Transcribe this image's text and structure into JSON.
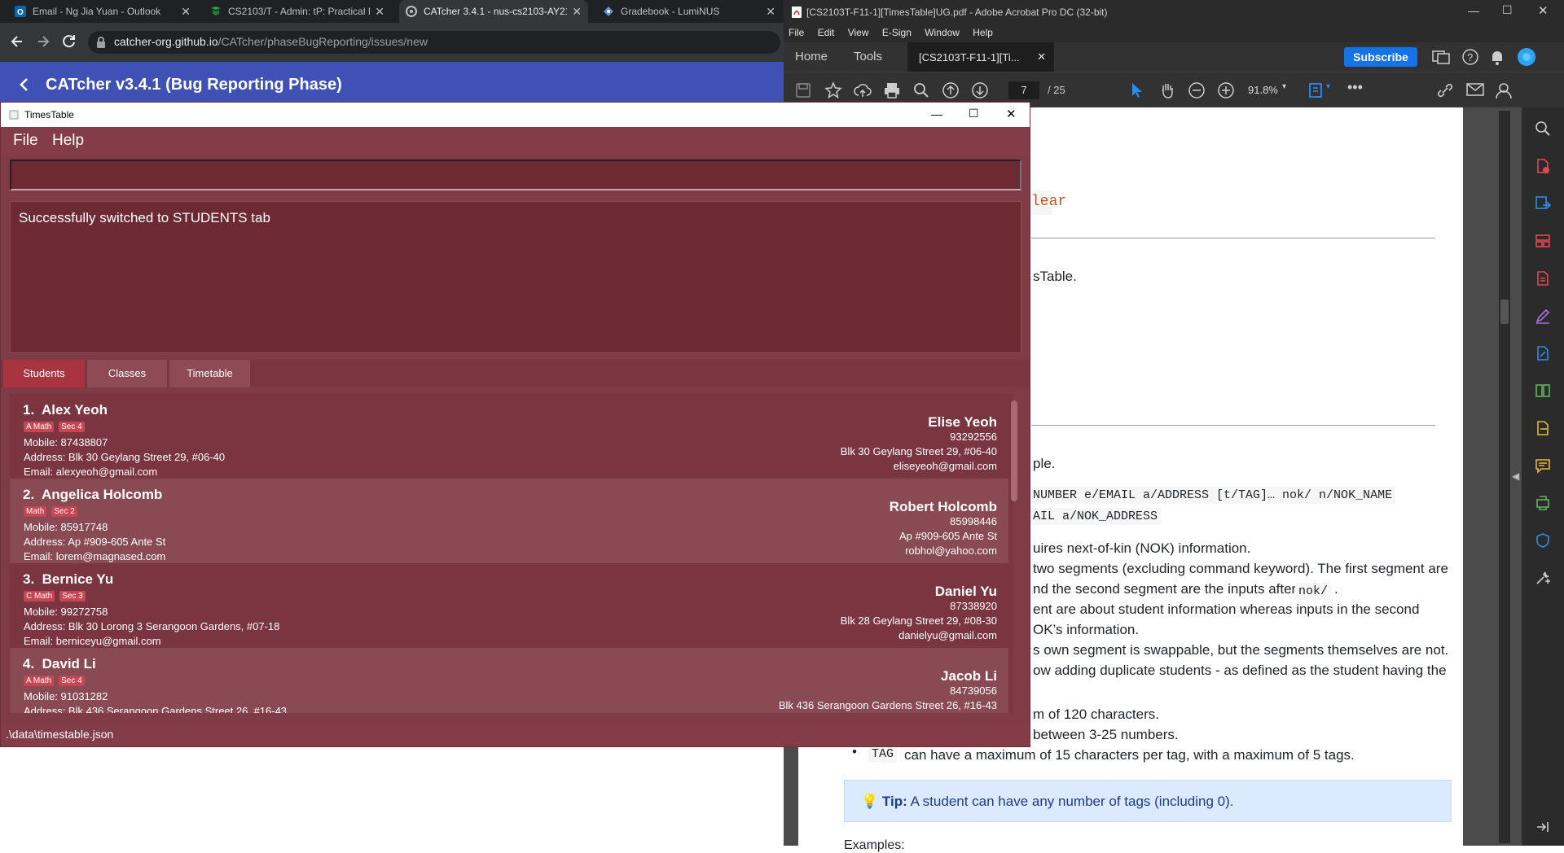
{
  "browser": {
    "tabs": [
      {
        "title": "Email - Ng Jia Yuan - Outlook",
        "active": false,
        "icon": "outlook-icon"
      },
      {
        "title": "CS2103/T - Admin: tP: Practical E",
        "active": false,
        "icon": "book-icon"
      },
      {
        "title": "CATcher 3.4.1 - nus-cs2103-AY21",
        "active": true,
        "icon": "catcher-icon"
      },
      {
        "title": "Gradebook - LumiNUS",
        "active": false,
        "icon": "luminus-icon"
      }
    ],
    "url_host": "catcher-org.github.io",
    "url_path": "/CATcher/phaseBugReporting/issues/new"
  },
  "catcher": {
    "title": "CATcher v3.4.1  (Bug Reporting Phase)",
    "header_color": "#3f51b5"
  },
  "acrobat": {
    "window_title": "[CS2103T-F11-1][TimesTable]UG.pdf - Adobe Acrobat Pro DC (32-bit)",
    "menu": [
      "File",
      "Edit",
      "View",
      "E-Sign",
      "Window",
      "Help"
    ],
    "tabs": {
      "home": "Home",
      "tools": "Tools",
      "doc": "[CS2103T-F11-1][Ti..."
    },
    "subscribe": "Subscribe",
    "page_current": "7",
    "page_total": "/ 25",
    "zoom": "91.8%",
    "doc": {
      "code_clear": "lear",
      "line_timestable": "sTable.",
      "line_ple": "ple.",
      "code_cmd1": "NUMBER e/EMAIL a/ADDRESS [t/TAG]… nok/ n/NOK_NAME",
      "code_cmd2": "AIL a/NOK_ADDRESS",
      "p1": "uires next-of-kin (NOK) information.",
      "p2": "two segments (excluding command keyword). The first segment are",
      "p3a": "nd the second segment are the inputs after",
      "p3code": "nok/",
      "p3b": ".",
      "p4": "ent are about student information whereas inputs in the second",
      "p5": "OK’s information.",
      "p6": "s own segment is swappable, but the segments themselves are not.",
      "p7": "ow adding duplicate students - as defined as the student having the",
      "p8": "m of 120 characters.",
      "p9": "between 3-25 numbers.",
      "bullet_code": "TAG",
      "bullet_text": "can have a maximum of 15 characters per tag, with a maximum of 5 tags.",
      "tip_label": "Tip:",
      "tip_text": "A student can have any number of tags (including 0).",
      "examples": "Examples:"
    }
  },
  "timestable": {
    "window_title": "TimesTable",
    "menu": {
      "file": "File",
      "help": "Help"
    },
    "command_value": "",
    "result": "Successfully switched to STUDENTS tab",
    "tabs": [
      "Students",
      "Classes",
      "Timetable"
    ],
    "selected_tab": "Students",
    "students": [
      {
        "index": "1.",
        "name": "Alex Yeoh",
        "tags": [
          "A Math",
          "Sec 4"
        ],
        "mobile": "Mobile: 87438807",
        "address": "Address: Blk 30 Geylang Street 29, #06-40",
        "email": "Email: alexyeoh@gmail.com",
        "nok_name": "Elise Yeoh",
        "nok_phone": "93292556",
        "nok_address": "Blk 30 Geylang Street 29, #06-40",
        "nok_email": "eliseyeoh@gmail.com"
      },
      {
        "index": "2.",
        "name": "Angelica Holcomb",
        "tags": [
          "Math",
          "Sec 2"
        ],
        "mobile": "Mobile: 85917748",
        "address": "Address: Ap #909-605 Ante St",
        "email": "Email: lorem@magnased.com",
        "nok_name": "Robert Holcomb",
        "nok_phone": "85998446",
        "nok_address": "Ap #909-605 Ante St",
        "nok_email": "robhol@yahoo.com"
      },
      {
        "index": "3.",
        "name": "Bernice Yu",
        "tags": [
          "C Math",
          "Sec 3"
        ],
        "mobile": "Mobile: 99272758",
        "address": "Address: Blk 30 Lorong 3 Serangoon Gardens, #07-18",
        "email": "Email: berniceyu@gmail.com",
        "nok_name": "Daniel Yu",
        "nok_phone": "87338920",
        "nok_address": "Blk 28 Geylang Street 29, #08-30",
        "nok_email": "danielyu@gmail.com"
      },
      {
        "index": "4.",
        "name": "David Li",
        "tags": [
          "A Math",
          "Sec 4"
        ],
        "mobile": "Mobile: 91031282",
        "address": "Address: Blk 436 Serangoon Gardens Street 26, #16-43",
        "email": "",
        "nok_name": "Jacob Li",
        "nok_phone": "84739056",
        "nok_address": "Blk 436 Serangoon Gardens Street 26, #16-43",
        "nok_email": ""
      }
    ],
    "status": ".\\data\\timestable.json",
    "theme": {
      "window": "#803c46",
      "tag": "#c84552",
      "selected_tab": "#a8343f"
    }
  }
}
